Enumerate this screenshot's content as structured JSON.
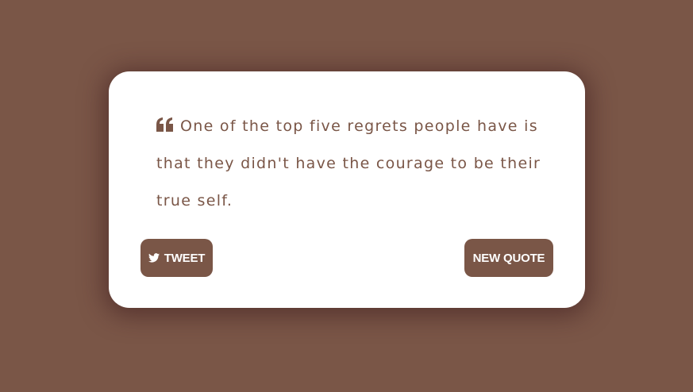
{
  "quote": {
    "icon": "quote-left-icon",
    "text": "One of the top five regrets people have is that they didn't have the courage to be their true self."
  },
  "buttons": {
    "tweet_icon": "twitter-icon",
    "tweet_label": "TWEET",
    "new_quote_label": "NEW QUOTE"
  },
  "colors": {
    "background": "#7a5647",
    "card": "#ffffff",
    "accent": "#7a5647"
  }
}
